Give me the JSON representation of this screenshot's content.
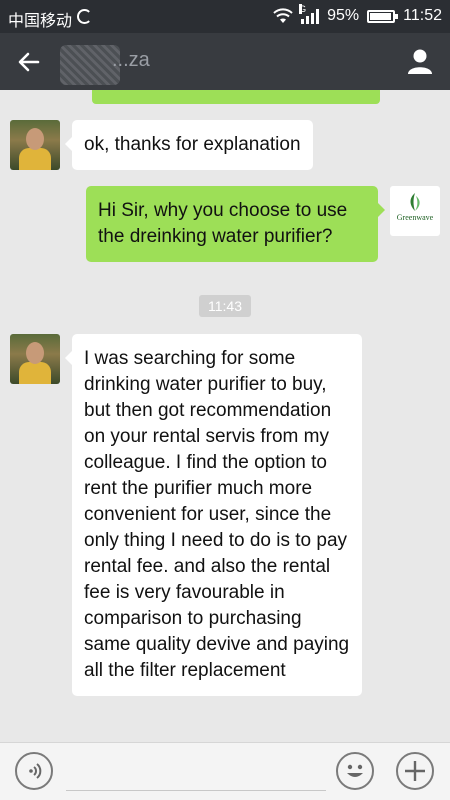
{
  "status_bar": {
    "carrier": "中国移动",
    "network_type": "G",
    "battery": "95%",
    "battery_level": 0.95,
    "time": "11:52"
  },
  "header": {
    "contact_name": "...za",
    "back_icon": "back-arrow-icon",
    "profile_icon": "person-icon"
  },
  "messages": [
    {
      "side": "left",
      "sender": "contact",
      "text": "ok, thanks for explanation"
    },
    {
      "side": "right",
      "sender": "me",
      "text": "Hi Sir, why you choose to use the dreinking water purifier?",
      "avatar_label": "Greenwave"
    },
    {
      "side": "left",
      "sender": "contact",
      "text": "I was searching for some drinking water purifier to buy, but then got recommendation on your rental servis from my colleague. I find the option to rent the purifier much more convenient for user, since the only thing I need to do is to pay rental fee. and also the rental fee is very favourable in comparison to purchasing same quality devive and paying all the filter replacement"
    }
  ],
  "timestamp": "11:43",
  "input_bar": {
    "placeholder": "",
    "voice_icon": "voice-icon",
    "emoji_icon": "emoji-icon",
    "plus_icon": "plus-icon"
  },
  "colors": {
    "header_bg": "#383b40",
    "status_bg": "#2b2e33",
    "outgoing_bubble": "#9ddf57",
    "incoming_bubble": "#ffffff",
    "chat_bg": "#e8e8e8"
  }
}
